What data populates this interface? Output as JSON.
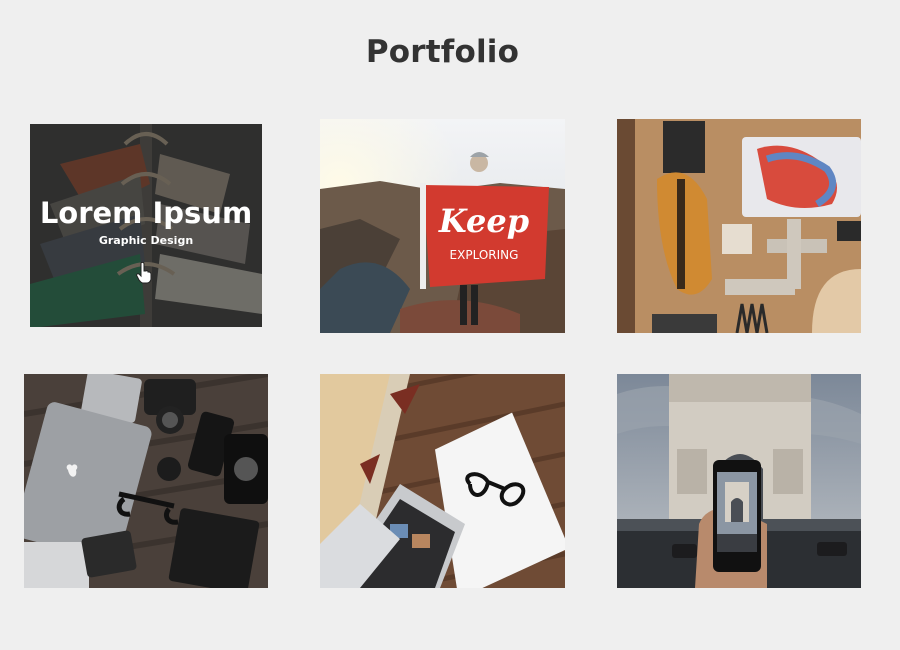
{
  "page": {
    "title": "Portfolio"
  },
  "portfolio": {
    "items": [
      {
        "image": "clothes-on-hangers",
        "hovered": true,
        "overlay_title": "Lorem Ipsum",
        "overlay_subtitle": "Graphic Design",
        "text": ""
      },
      {
        "image": "person-holding-flag",
        "hovered": false,
        "text": "Keep",
        "subtext": "EXPLORING"
      },
      {
        "image": "guitar-and-letters-on-desk",
        "hovered": false,
        "text": ""
      },
      {
        "image": "laptop-camera-flatlay",
        "hovered": false,
        "text": ""
      },
      {
        "image": "laptop-glasses-notebook",
        "hovered": false,
        "text": ""
      },
      {
        "image": "arc-de-triomphe-phone",
        "hovered": false,
        "text": ""
      }
    ]
  },
  "colors": {
    "background": "#efefef",
    "title": "#333333",
    "overlay": "#191919"
  },
  "icons": {
    "cursor": "hand-pointer-icon"
  }
}
